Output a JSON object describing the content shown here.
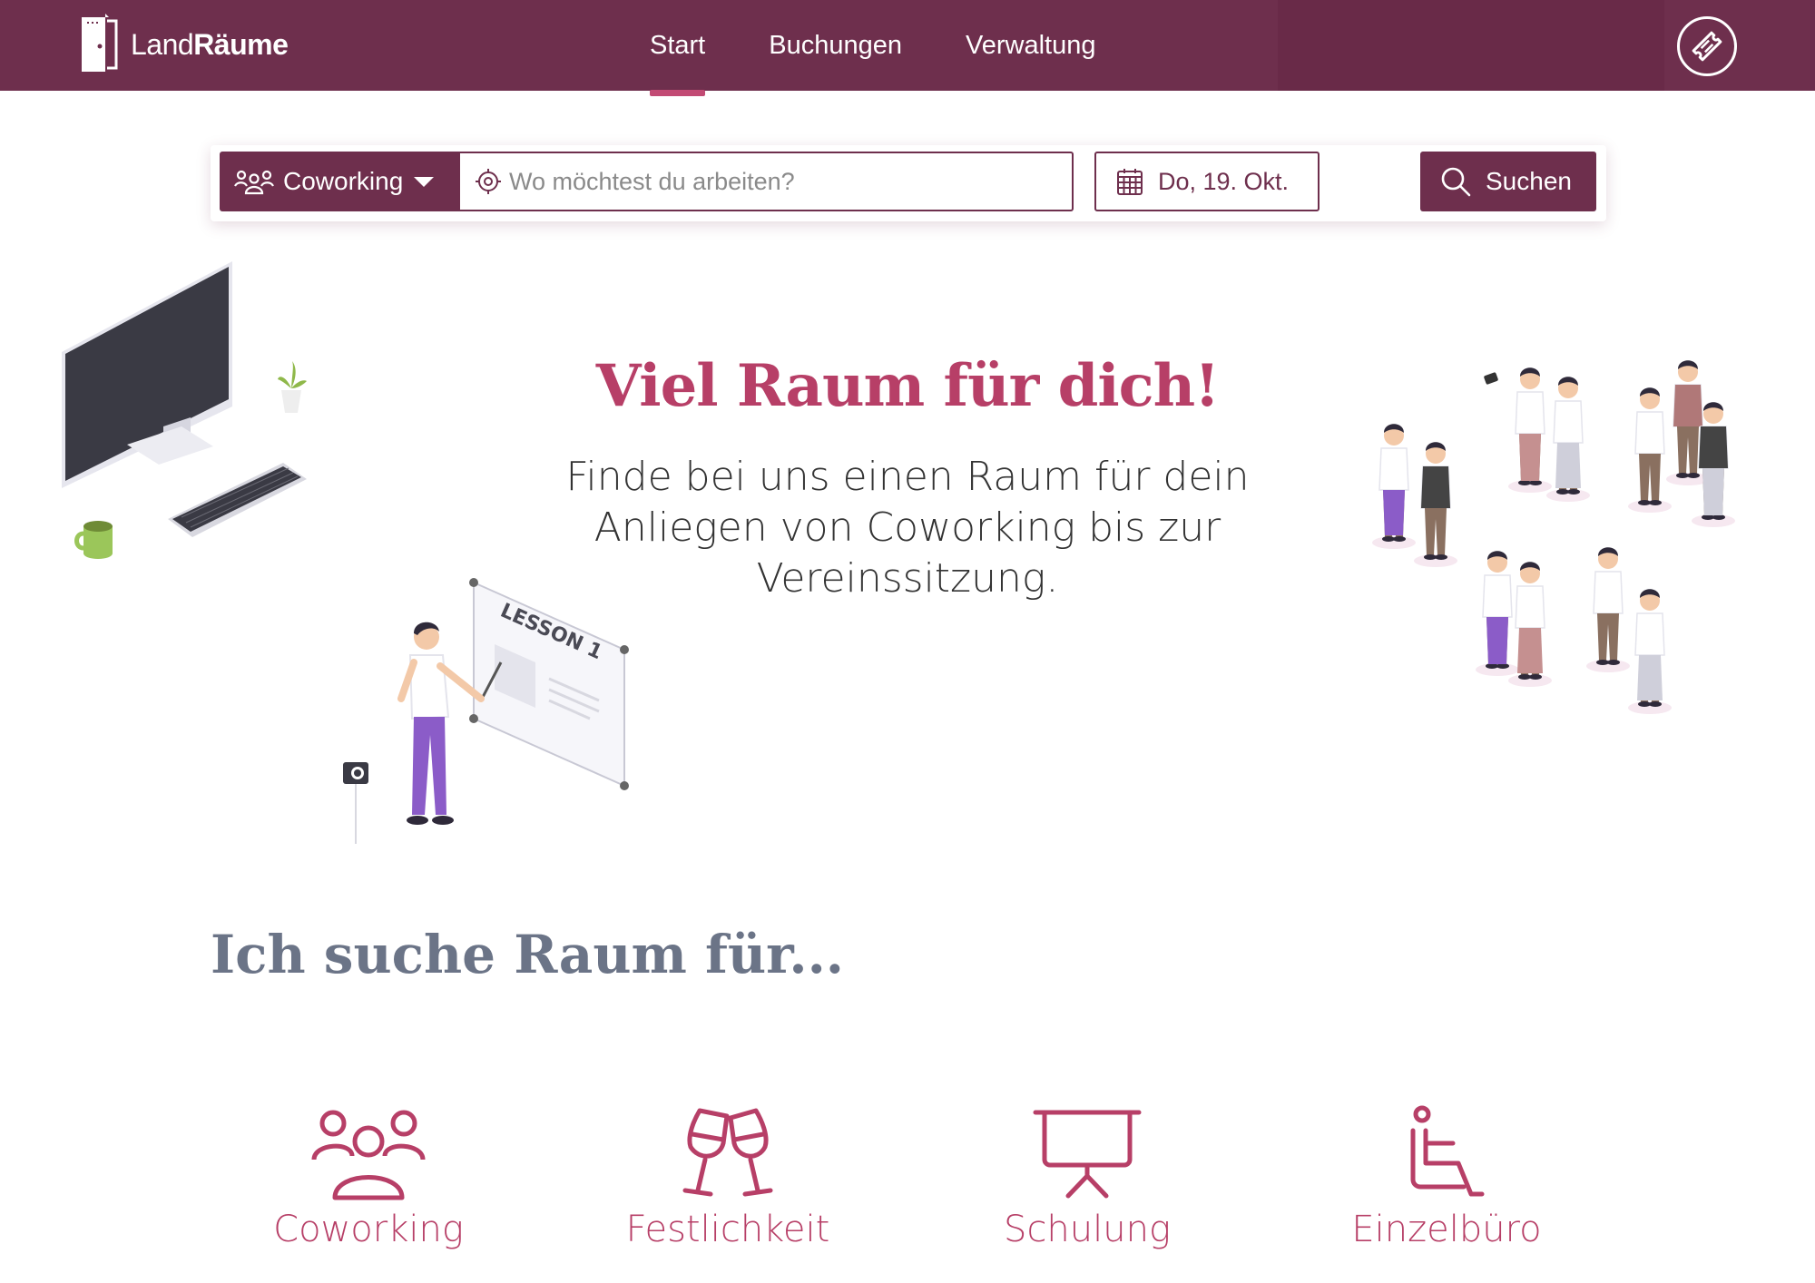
{
  "brand": {
    "name_light": "Land",
    "name_bold": "Räume"
  },
  "nav": {
    "items": [
      {
        "label": "Start",
        "active": true
      },
      {
        "label": "Buchungen",
        "active": false
      },
      {
        "label": "Verwaltung",
        "active": false
      }
    ]
  },
  "search": {
    "category": "Coworking",
    "location_placeholder": "Wo möchtest du arbeiten?",
    "location_value": "",
    "date": "Do, 19. Okt.",
    "button_label": "Suchen"
  },
  "hero": {
    "title": "Viel Raum für dich!",
    "subtitle": "Finde bei uns einen Raum für dein Anliegen von Coworking bis zur Vereinssitzung.",
    "whiteboard_text": "LESSON 1"
  },
  "categories": {
    "heading": "Ich suche Raum für...",
    "items": [
      {
        "label": "Coworking",
        "icon": "people-group-icon"
      },
      {
        "label": "Festlichkeit",
        "icon": "wine-glasses-icon"
      },
      {
        "label": "Schulung",
        "icon": "presentation-board-icon"
      },
      {
        "label": "Einzelbüro",
        "icon": "office-chair-icon"
      }
    ]
  },
  "colors": {
    "primary": "#6e2f4d",
    "accent": "#b73f67",
    "nav_underline": "#c24a74",
    "heading_gray": "#6b7487"
  }
}
